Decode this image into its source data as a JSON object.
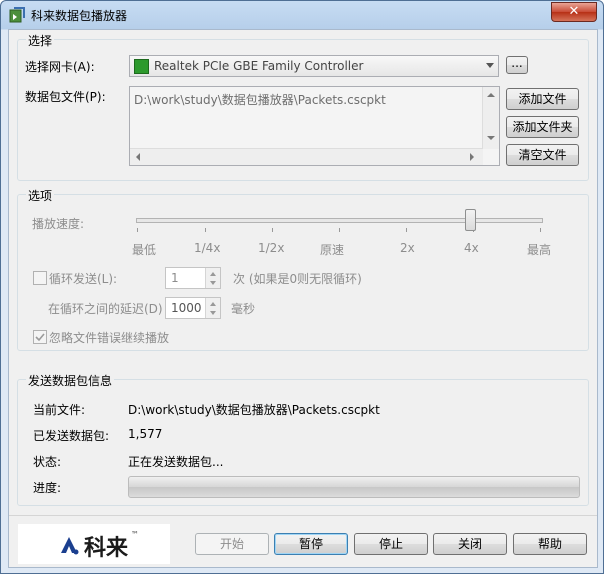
{
  "window": {
    "title": "科来数据包播放器",
    "close_glyph": "✕",
    "icon": "packet-player-icon"
  },
  "select_group": {
    "title": "选择",
    "nic_label": "选择网卡(A):",
    "nic_value": "Realtek PCIe GBE Family Controller",
    "nic_icon": "network-card-icon",
    "browse_label": "...",
    "files_label": "数据包文件(P):",
    "files": [
      "D:\\work\\study\\数据包播放器\\Packets.cscpkt"
    ],
    "add_file": "添加文件",
    "add_folder": "添加文件夹",
    "clear_files": "清空文件"
  },
  "options_group": {
    "title": "选项",
    "speed_label": "播放速度:",
    "speed_ticks": [
      "最低",
      "1/4x",
      "1/2x",
      "原速",
      "2x",
      "4x",
      "最高"
    ],
    "speed_selected": "4x",
    "loop_label": "循环发送(L):",
    "loop_checked": false,
    "loop_count": "1",
    "loop_hint": "次 (如果是0则无限循环)",
    "delay_label": "在循环之间的延迟(D)",
    "delay_value": "1000",
    "delay_unit": "毫秒",
    "ignore_errors_label": "忽略文件错误继续播放",
    "ignore_errors_checked": true
  },
  "info_group": {
    "title": "发送数据包信息",
    "current_file_label": "当前文件:",
    "current_file": "D:\\work\\study\\数据包播放器\\Packets.cscpkt",
    "sent_label": "已发送数据包:",
    "sent_count": "1,577",
    "status_label": "状态:",
    "status_value": "正在发送数据包...",
    "progress_label": "进度:",
    "progress": 0
  },
  "footer": {
    "logo_text": "科来",
    "logo_mark": "™",
    "start": "开始",
    "pause": "暂停",
    "stop": "停止",
    "close": "关闭",
    "help": "帮助"
  },
  "colors": {
    "title_gradient_top": "#c7dcf3",
    "close_red": "#c84a35",
    "nic_green": "#2d9a2d",
    "focus_blue": "#3c7fb1"
  }
}
